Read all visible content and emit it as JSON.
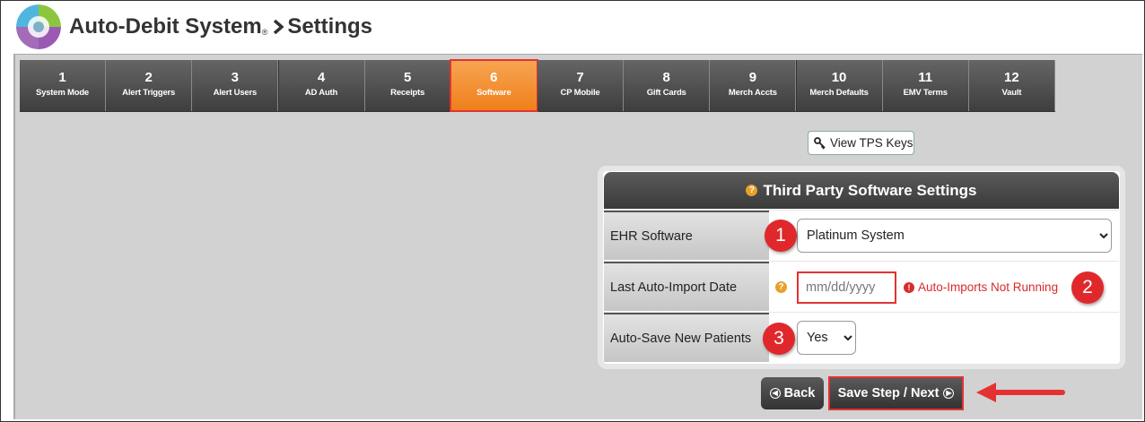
{
  "header": {
    "app_name": "Auto-Debit System",
    "reg_mark": "®",
    "page": "Settings"
  },
  "tabs": [
    {
      "num": "1",
      "label": "System Mode"
    },
    {
      "num": "2",
      "label": "Alert Triggers"
    },
    {
      "num": "3",
      "label": "Alert Users"
    },
    {
      "num": "4",
      "label": "AD Auth"
    },
    {
      "num": "5",
      "label": "Receipts"
    },
    {
      "num": "6",
      "label": "Software"
    },
    {
      "num": "7",
      "label": "CP Mobile"
    },
    {
      "num": "8",
      "label": "Gift Cards"
    },
    {
      "num": "9",
      "label": "Merch Accts"
    },
    {
      "num": "10",
      "label": "Merch Defaults"
    },
    {
      "num": "11",
      "label": "EMV Terms"
    },
    {
      "num": "12",
      "label": "Vault"
    }
  ],
  "active_tab": "6",
  "view_keys_label": "View TPS Keys",
  "settings": {
    "title": "Third Party Software Settings",
    "ehr": {
      "label": "EHR Software",
      "value": "Platinum System"
    },
    "last_import": {
      "label": "Last Auto-Import Date",
      "placeholder": "mm/dd/yyyy",
      "warning": "Auto-Imports Not Running"
    },
    "auto_save": {
      "label": "Auto-Save New Patients",
      "value": "Yes"
    }
  },
  "callouts": [
    "1",
    "2",
    "3"
  ],
  "buttons": {
    "back": "Back",
    "next": "Save Step / Next"
  },
  "colors": {
    "accent": "#ef7f1a",
    "highlight": "#e43232",
    "header_bar": "#3e3e3e",
    "panel": "#d2d2d2"
  }
}
